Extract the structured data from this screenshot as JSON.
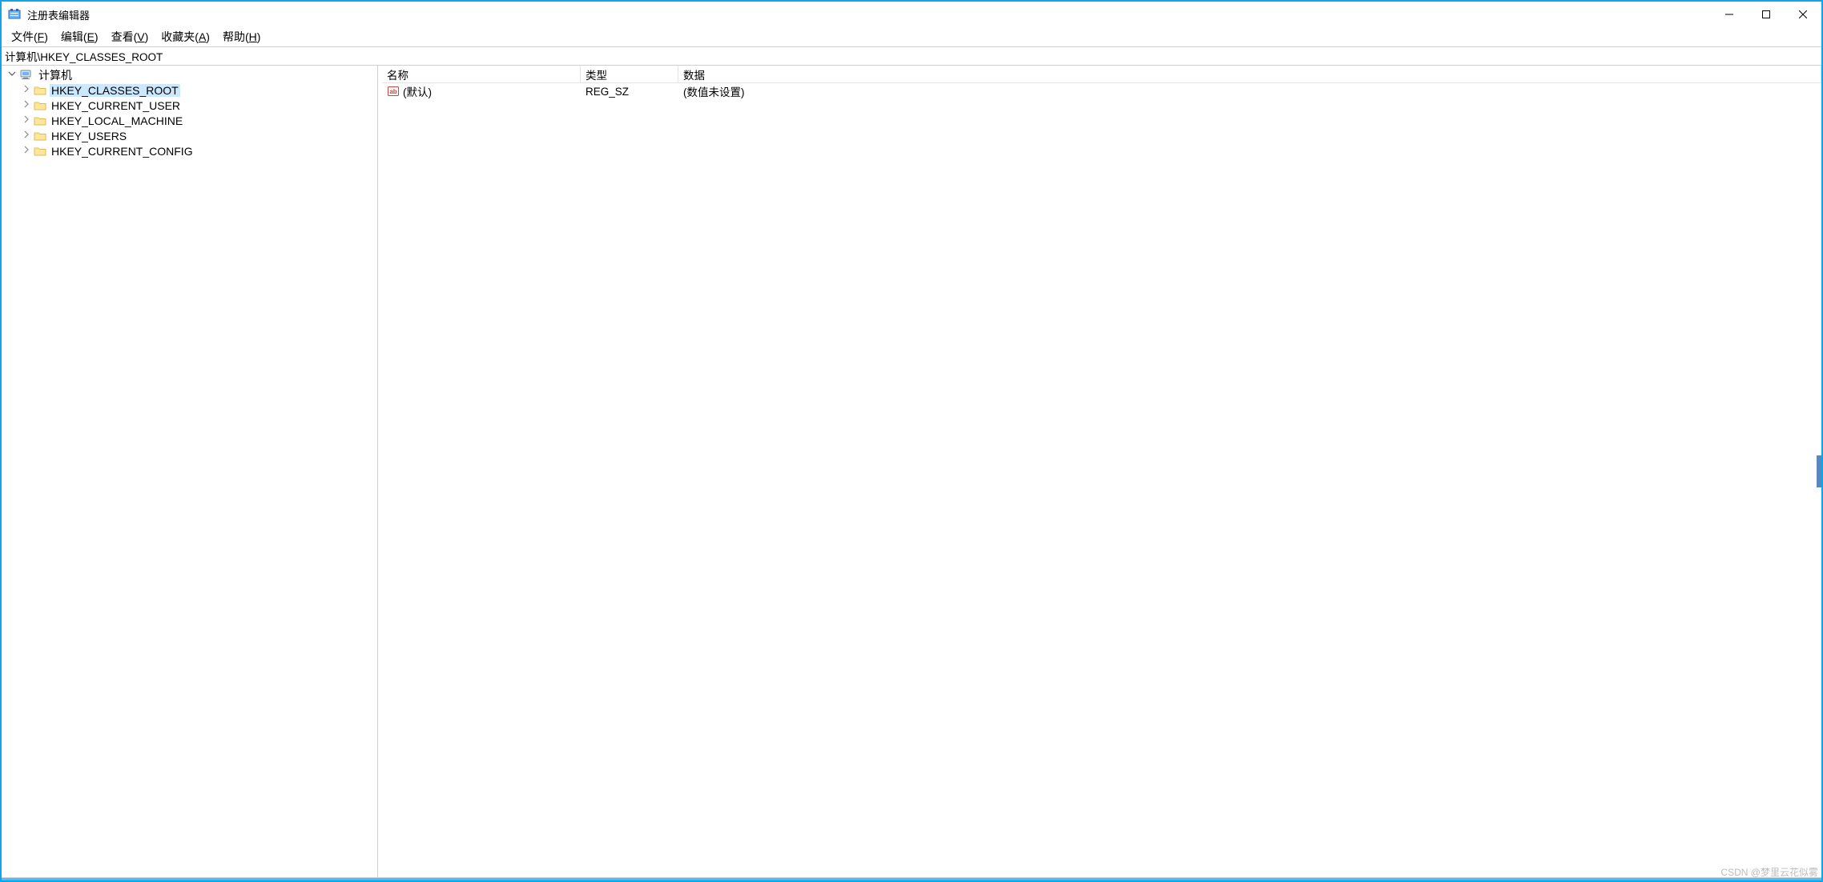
{
  "title": "注册表编辑器",
  "menu": {
    "file": "文件(F)",
    "edit": "编辑(E)",
    "view": "查看(V)",
    "favorites": "收藏夹(A)",
    "help": "帮助(H)",
    "file_u": "F",
    "edit_u": "E",
    "view_u": "V",
    "favorites_u": "A",
    "help_u": "H",
    "file_pre": "文件(",
    "edit_pre": "编辑(",
    "view_pre": "查看(",
    "favorites_pre": "收藏夹(",
    "help_pre": "帮助(",
    "post": ")"
  },
  "address": "计算机\\HKEY_CLASSES_ROOT",
  "tree": {
    "root": "计算机",
    "hives": [
      {
        "name": "HKEY_CLASSES_ROOT",
        "selected": true
      },
      {
        "name": "HKEY_CURRENT_USER",
        "selected": false
      },
      {
        "name": "HKEY_LOCAL_MACHINE",
        "selected": false
      },
      {
        "name": "HKEY_USERS",
        "selected": false
      },
      {
        "name": "HKEY_CURRENT_CONFIG",
        "selected": false
      }
    ]
  },
  "columns": {
    "name": "名称",
    "type": "类型",
    "data": "数据"
  },
  "values": [
    {
      "name": "(默认)",
      "type": "REG_SZ",
      "data": "(数值未设置)",
      "icon": "string"
    }
  ],
  "watermark": "CSDN @梦里云花似雾"
}
